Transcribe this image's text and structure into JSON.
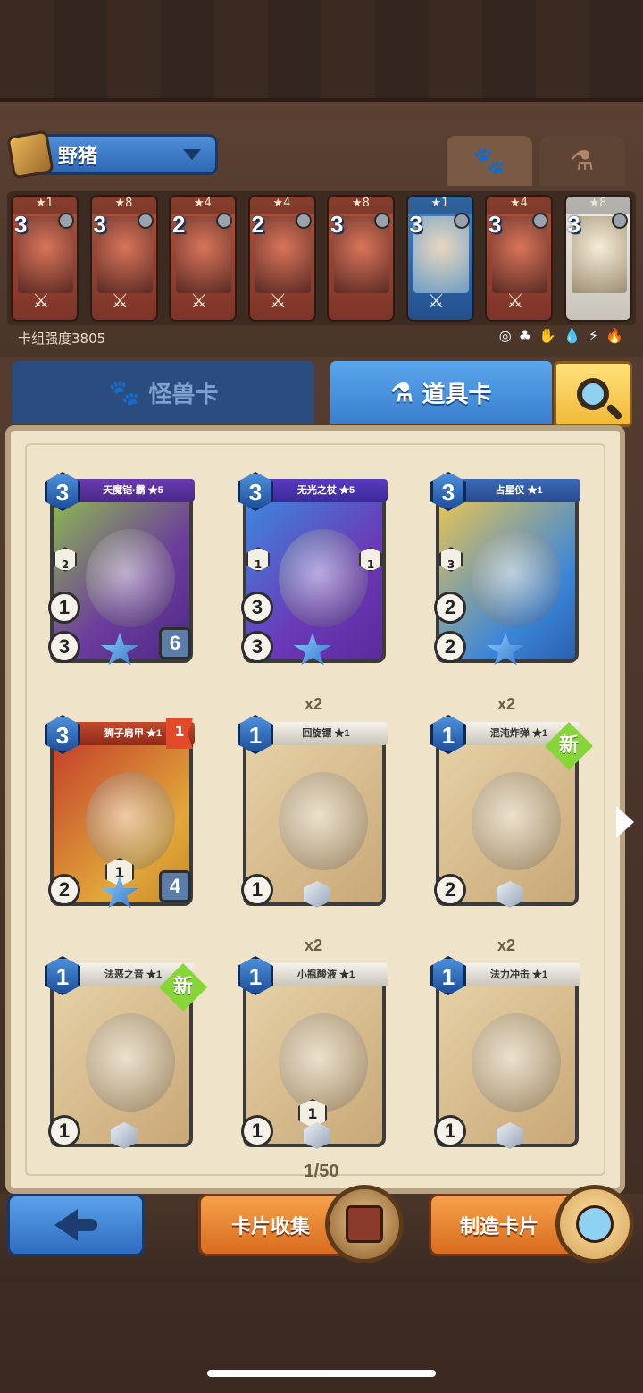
{
  "deck": {
    "name": "野猪",
    "strength": "卡组强度3805",
    "stat_icons": [
      "◎",
      "♣",
      "✋",
      "💧",
      "⚡",
      "🔥"
    ],
    "cards": [
      {
        "stars": "★1",
        "cost": "3",
        "weapon": "⚔",
        "color": "red"
      },
      {
        "stars": "★8",
        "cost": "3",
        "weapon": "⚔",
        "color": "red"
      },
      {
        "stars": "★4",
        "cost": "2",
        "weapon": "⚔",
        "color": "red"
      },
      {
        "stars": "★4",
        "cost": "2",
        "weapon": "⚔",
        "color": "red"
      },
      {
        "stars": "★8",
        "cost": "3",
        "weapon": "",
        "color": "red"
      },
      {
        "stars": "★1",
        "cost": "3",
        "weapon": "⚔",
        "color": "blue"
      },
      {
        "stars": "★4",
        "cost": "3",
        "weapon": "⚔",
        "color": "red"
      },
      {
        "stars": "★8",
        "cost": "3",
        "weapon": "",
        "color": "white"
      }
    ]
  },
  "tabs": {
    "monster": "怪兽卡",
    "item": "道具卡"
  },
  "items": [
    {
      "name": "天魔铠·霸 ★5",
      "cost": "3",
      "style": "purple",
      "stats": [
        "3",
        "1"
      ],
      "right": "6",
      "slots": [
        "2"
      ]
    },
    {
      "name": "无光之杖 ★5",
      "cost": "3",
      "style": "blueviolet",
      "stats": [
        "3",
        "3"
      ],
      "slots": [
        "1",
        "1"
      ]
    },
    {
      "name": "占星仪 ★1",
      "cost": "3",
      "style": "gold",
      "stats": [
        "2",
        "2"
      ],
      "slots": [
        "3"
      ]
    },
    {
      "name": "狮子肩甲 ★1",
      "cost": "3",
      "style": "redgold",
      "stats": [
        "2"
      ],
      "right": "4",
      "mid": "1",
      "flag": "1"
    },
    {
      "name": "回旋镖 ★1",
      "cost": "1",
      "style": "plain",
      "qty": "x2",
      "stats": [
        "1"
      ]
    },
    {
      "name": "混沌炸弹 ★1",
      "cost": "1",
      "style": "plain",
      "qty": "x2",
      "stats": [
        "2"
      ],
      "new": "新"
    },
    {
      "name": "法恶之音 ★1",
      "cost": "1",
      "style": "plain",
      "stats": [
        "1"
      ],
      "new": "新"
    },
    {
      "name": "小瓶酸液 ★1",
      "cost": "1",
      "style": "plain",
      "qty": "x2",
      "stats": [
        "1"
      ],
      "mid": "1"
    },
    {
      "name": "法力冲击 ★1",
      "cost": "1",
      "style": "plain",
      "qty": "x2",
      "stats": [
        "1"
      ]
    }
  ],
  "pagination": "1/50",
  "buttons": {
    "collection": "卡片收集",
    "craft": "制造卡片"
  }
}
